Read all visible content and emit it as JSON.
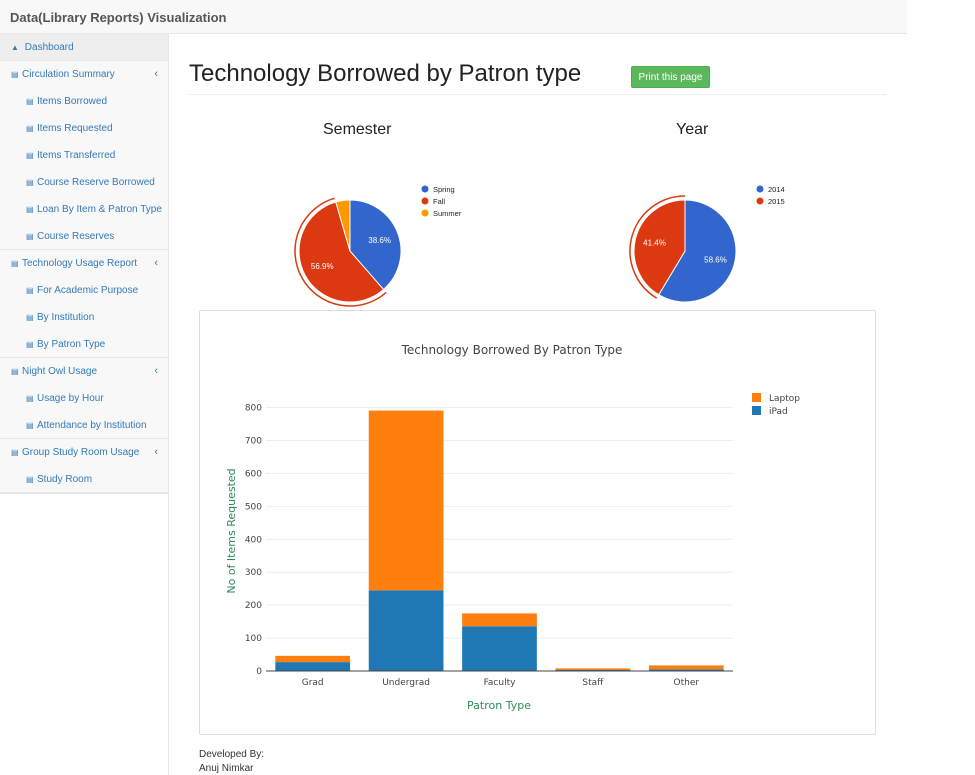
{
  "app": {
    "title": "Data(Library Reports) Visualization"
  },
  "sidebar": {
    "dashboard": "Dashboard",
    "groups": [
      {
        "label": "Circulation Summary",
        "items": [
          "Items Borrowed",
          "Items Requested",
          "Items Transferred",
          "Course Reserve Borrowed",
          "Loan By Item & Patron Type",
          "Course Reserves"
        ]
      },
      {
        "label": "Technology Usage Report",
        "items": [
          "For Academic Purpose",
          "By Institution",
          "By Patron Type"
        ]
      },
      {
        "label": "Night Owl Usage",
        "items": [
          "Usage by Hour",
          "Attendance by Institution"
        ]
      },
      {
        "label": "Group Study Room Usage",
        "items": [
          "Study Room"
        ]
      }
    ]
  },
  "page": {
    "title": "Technology Borrowed by Patron type",
    "print_label": "Print this page"
  },
  "footer": {
    "line1": "Developed By:",
    "line2": "Anuj Nimkar"
  },
  "chart_data": [
    {
      "type": "pie",
      "title": "Semester",
      "labels": [
        "Spring",
        "Fall",
        "Summer"
      ],
      "values": [
        38.6,
        56.9,
        4.5
      ],
      "data_labels": [
        "38.6%",
        "56.9%",
        ""
      ],
      "colors": [
        "#3366cc",
        "#dc3912",
        "#ff9900"
      ],
      "legend": "right"
    },
    {
      "type": "pie",
      "title": "Year",
      "labels": [
        "2014",
        "2015"
      ],
      "values": [
        58.6,
        41.4
      ],
      "data_labels": [
        "58.6%",
        "41.4%"
      ],
      "colors": [
        "#3366cc",
        "#dc3912"
      ],
      "legend": "right"
    },
    {
      "type": "bar",
      "stacked": true,
      "title": "Technology Borrowed By Patron Type",
      "xlabel": "Patron Type",
      "ylabel": "No of Items Requested",
      "categories": [
        "Grad",
        "Undergrad",
        "Faculty",
        "Staff",
        "Other"
      ],
      "series": [
        {
          "name": "iPad",
          "values": [
            27,
            245,
            136,
            3,
            5
          ],
          "color": "#1f77b4"
        },
        {
          "name": "Laptop",
          "values": [
            19,
            546,
            39,
            5,
            12
          ],
          "color": "#ff7f0e"
        }
      ],
      "ylim": [
        0,
        820
      ],
      "yticks": [
        0,
        100,
        200,
        300,
        400,
        500,
        600,
        700,
        800
      ],
      "grid": true,
      "legend": "top-right"
    }
  ]
}
